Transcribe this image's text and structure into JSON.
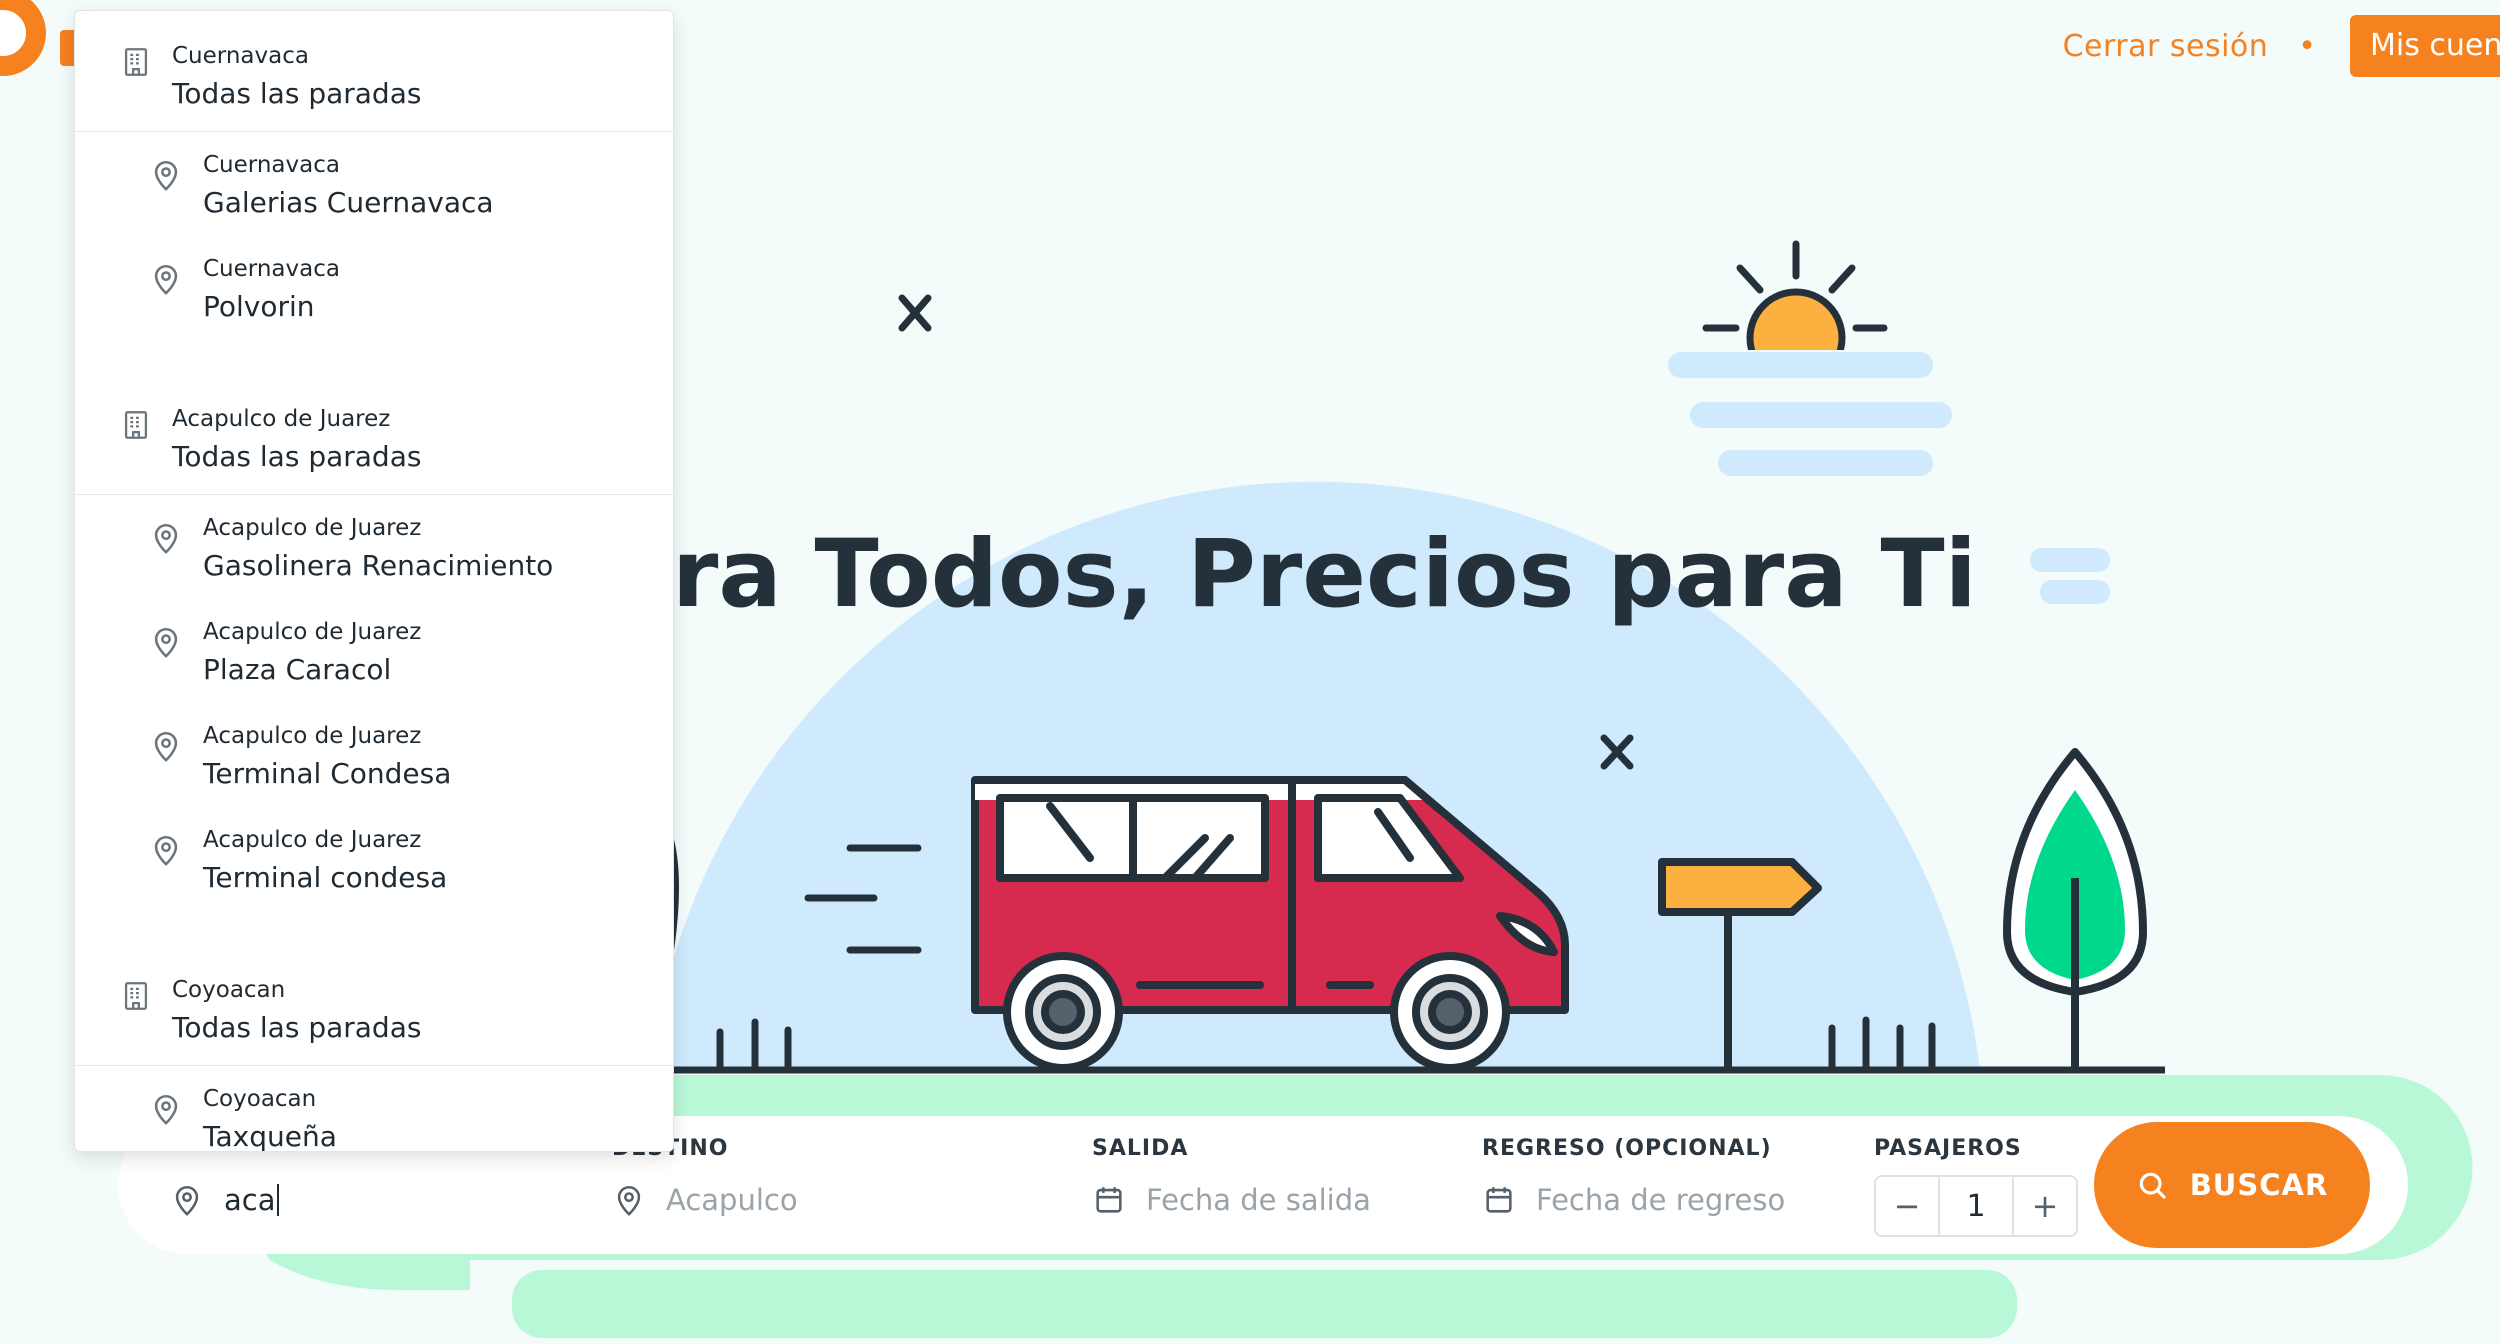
{
  "header": {
    "logout_label": "Cerrar sesión",
    "separator": "•",
    "account_label": "Mis cuentas"
  },
  "hero": {
    "title_visible": "as para Todos, Precios para Ti"
  },
  "search": {
    "origin": {
      "value": "aca"
    },
    "destination": {
      "label": "DESTINO",
      "placeholder": "Acapulco"
    },
    "departure": {
      "label": "SALIDA",
      "placeholder": "Fecha de salida"
    },
    "return": {
      "label": "REGRESO (OPCIONAL)",
      "placeholder": "Fecha de regreso"
    },
    "passengers": {
      "label": "PASAJEROS",
      "minus": "−",
      "value": "1",
      "plus": "+"
    },
    "button_label": "BUSCAR"
  },
  "dropdown": {
    "items": [
      {
        "kind": "group",
        "city": "Cuernavaca",
        "name": "Todas las paradas"
      },
      {
        "kind": "stop",
        "city": "Cuernavaca",
        "name": "Galerias Cuernavaca"
      },
      {
        "kind": "stop",
        "city": "Cuernavaca",
        "name": "Polvorin"
      },
      {
        "kind": "group",
        "city": "Acapulco de Juarez",
        "name": "Todas las paradas"
      },
      {
        "kind": "stop",
        "city": "Acapulco de Juarez",
        "name": "Gasolinera Renacimiento"
      },
      {
        "kind": "stop",
        "city": "Acapulco de Juarez",
        "name": "Plaza Caracol"
      },
      {
        "kind": "stop",
        "city": "Acapulco de Juarez",
        "name": "Terminal Condesa"
      },
      {
        "kind": "stop",
        "city": "Acapulco de Juarez",
        "name": "Terminal condesa"
      },
      {
        "kind": "group",
        "city": "Coyoacan",
        "name": "Todas las paradas"
      },
      {
        "kind": "stop",
        "city": "Coyoacan",
        "name": "Taxqueña"
      }
    ]
  },
  "colors": {
    "accent": "#f5821f",
    "van_body": "#d62a4f",
    "hill": "#cfeafd",
    "ground": "#b9f8d6",
    "tree": "#00d98b",
    "sun": "#fbb040"
  },
  "icons": [
    "building-icon",
    "location-pin-icon",
    "calendar-icon",
    "search-icon"
  ]
}
